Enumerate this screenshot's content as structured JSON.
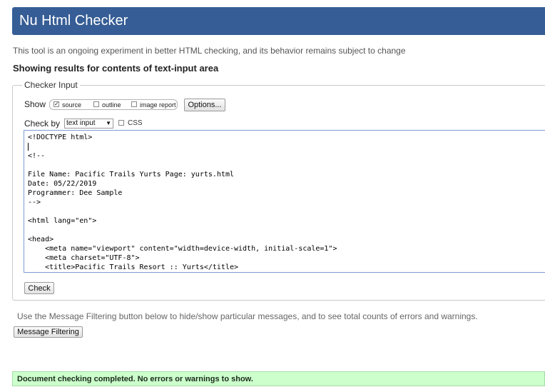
{
  "header": {
    "title": "Nu Html Checker"
  },
  "intro_text": "This tool is an ongoing experiment in better HTML checking, and its behavior remains subject to change",
  "results_heading": "Showing results for contents of text-input area",
  "checker_input": {
    "legend": "Checker Input",
    "show_label": "Show",
    "show_options": [
      {
        "label": "source",
        "checked": true
      },
      {
        "label": "outline",
        "checked": false
      },
      {
        "label": "image report",
        "checked": false
      }
    ],
    "options_button": "Options...",
    "check_by_label": "Check by",
    "check_by_value": "text input",
    "css_label": "CSS",
    "css_checked": false,
    "code_lines": [
      "<!DOCTYPE html>",
      "",
      "<!--",
      "",
      "File Name: Pacific Trails Yurts Page: yurts.html",
      "Date: 05/22/2019",
      "Programmer: Dee Sample",
      "-->",
      "",
      "<html lang=\"en\">",
      "",
      "<head>",
      "    <meta name=\"viewport\" content=\"width=device-width, initial-scale=1\">",
      "    <meta charset=\"UTF-8\">",
      "    <title>Pacific Trails Resort :: Yurts</title>"
    ],
    "check_button": "Check"
  },
  "filter": {
    "description": "Use the Message Filtering button below to hide/show particular messages, and to see total counts of errors and warnings.",
    "button": "Message Filtering"
  },
  "status": {
    "message": "Document checking completed. No errors or warnings to show.",
    "color": "#ccffcc"
  },
  "colors": {
    "header_bg": "#365d95",
    "textarea_border": "#7a9cd3"
  }
}
